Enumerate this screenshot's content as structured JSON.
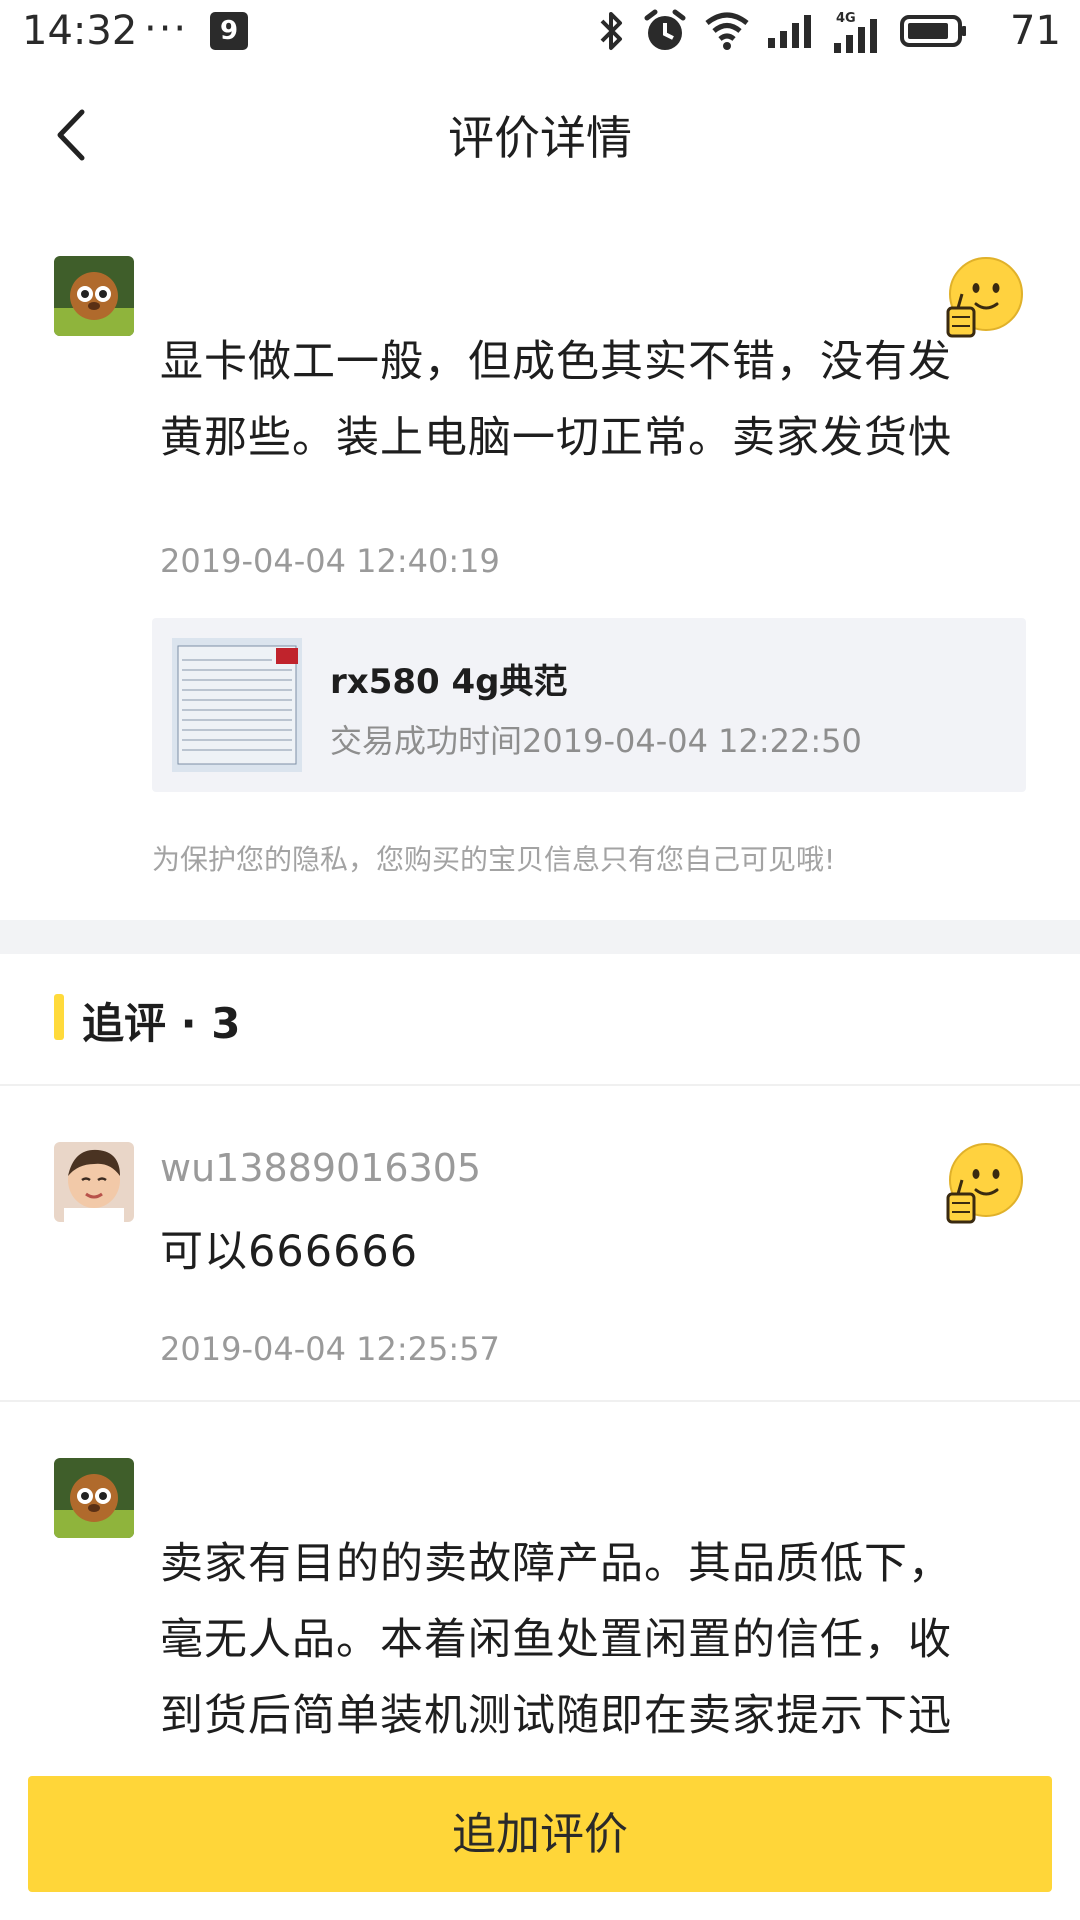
{
  "status_bar": {
    "time": "14:32",
    "dots": "···",
    "app_icon_glyph": "9",
    "battery_level": "71",
    "network_label": "4G"
  },
  "header": {
    "title": "评价详情"
  },
  "main_review": {
    "text": "显卡做工一般，但成色其实不错，没有发黄那些。装上电脑一切正常。卖家发货快",
    "timestamp": "2019-04-04 12:40:19",
    "product": {
      "name": "rx580 4g典范",
      "trade_time": "交易成功时间2019-04-04 12:22:50"
    },
    "privacy_note": "为保护您的隐私，您购买的宝贝信息只有您自己可见哦!"
  },
  "followups": {
    "title": "追评 · 3",
    "items": [
      {
        "username": "wu13889016305",
        "text": "可以666666",
        "timestamp": "2019-04-04 12:25:57"
      },
      {
        "text": "卖家有目的的卖故障产品。其品质低下，毫无人品。本着闲鱼处置闲置的信任，收到货后简单装机测试随即在卖家提示下迅"
      }
    ]
  },
  "footer": {
    "add_review_label": "追加评价"
  },
  "colors": {
    "accent": "#ffd639",
    "section_gap": "#f2f3f5",
    "card_bg": "#f2f3f7"
  }
}
